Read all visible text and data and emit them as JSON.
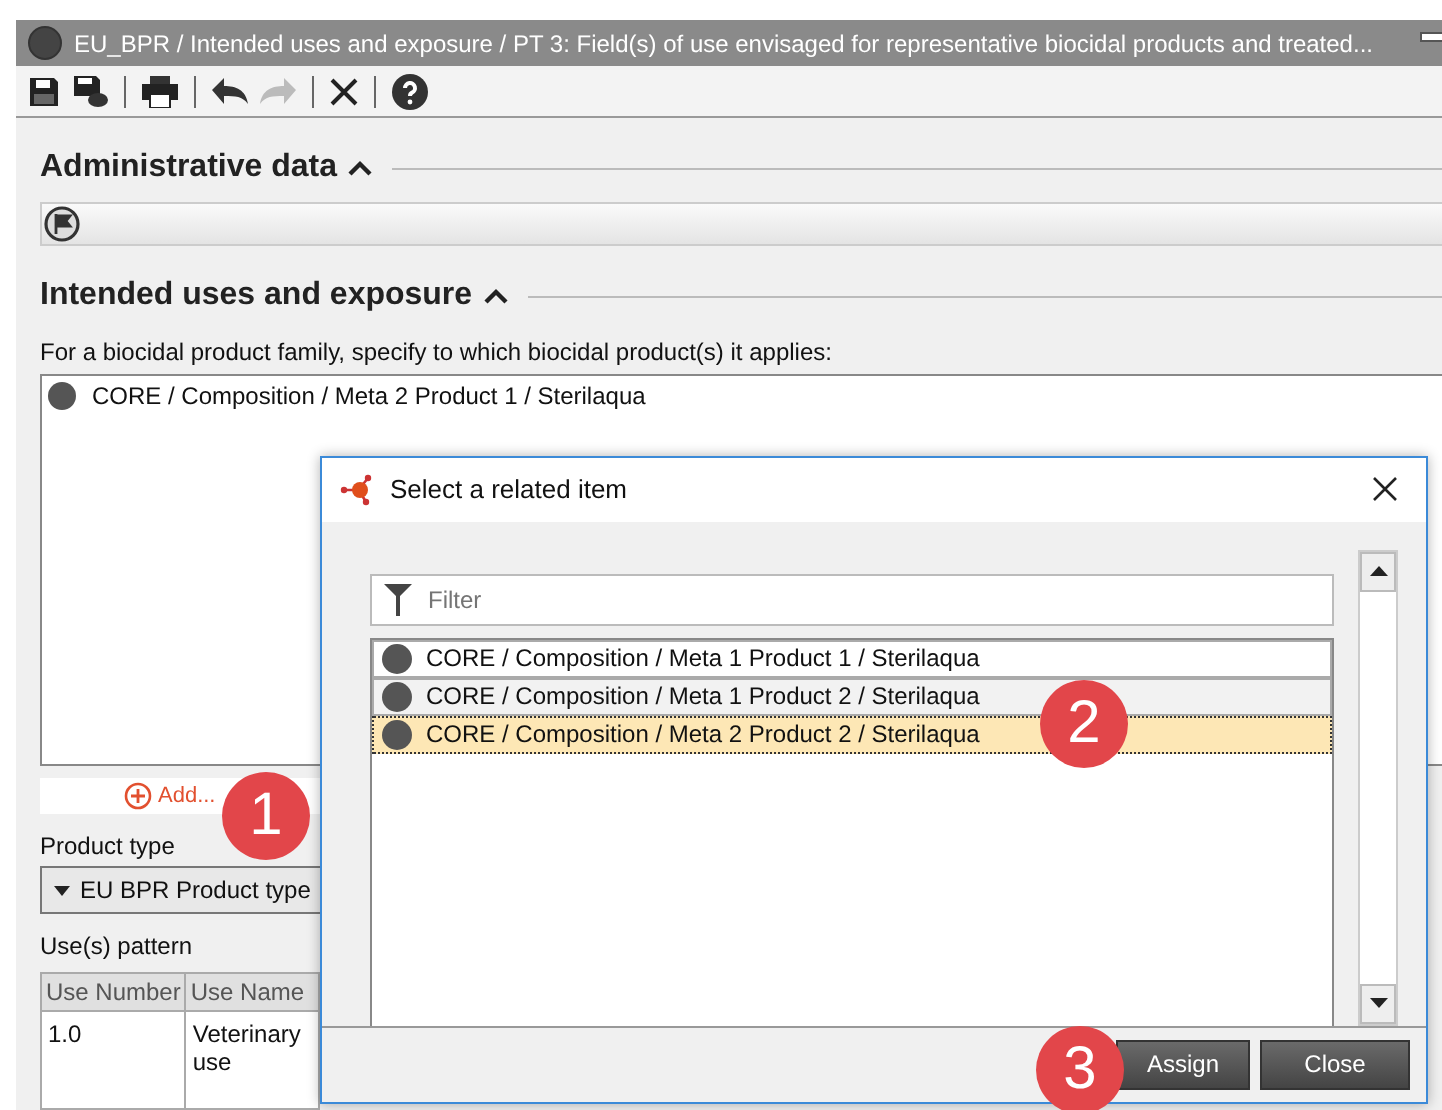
{
  "window": {
    "title": "EU_BPR / Intended uses and exposure / PT 3: Field(s) of use envisaged for representative biocidal products and treated..."
  },
  "administrative": {
    "heading": "Administrative data"
  },
  "intended": {
    "heading": "Intended uses and exposure",
    "instruction": "For a biocidal product family, specify to which biocidal product(s) it applies:",
    "linked_items": [
      "CORE / Composition / Meta 2 Product 1 / Sterilaqua"
    ],
    "add_label": "Add...",
    "product_type_label": "Product type",
    "product_type_value": "EU BPR Product type",
    "uses_label": "Use(s) pattern",
    "table": {
      "columns": [
        "Use Number",
        "Use Name"
      ],
      "rows": [
        [
          "1.0",
          "Veterinary use"
        ]
      ]
    }
  },
  "dialog": {
    "title": "Select a related item",
    "filter": {
      "placeholder": "Filter"
    },
    "items": [
      {
        "label": "CORE / Composition / Meta 1 Product 1 / Sterilaqua",
        "selected": false
      },
      {
        "label": "CORE / Composition / Meta 1 Product 2 / Sterilaqua",
        "selected": false
      },
      {
        "label": "CORE / Composition / Meta 2 Product 2 / Sterilaqua",
        "selected": true
      }
    ],
    "buttons": [
      "Assign",
      "Close"
    ]
  },
  "callouts": [
    "1",
    "2",
    "3"
  ]
}
